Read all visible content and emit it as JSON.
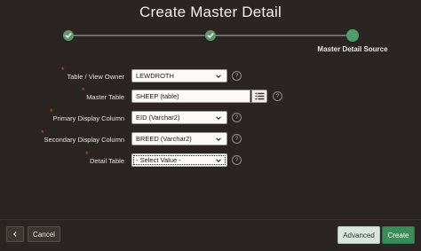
{
  "dialog": {
    "title": "Create Master Detail"
  },
  "wizard": {
    "steps": [
      {
        "state": "complete",
        "icon": "check-icon"
      },
      {
        "state": "complete",
        "icon": "check-icon"
      },
      {
        "state": "current",
        "label": "Master Detail Source"
      }
    ]
  },
  "form": {
    "table_owner": {
      "label": "Table / View Owner",
      "required": "*",
      "value": "LEWDROTH"
    },
    "master_table": {
      "label": "Master Table",
      "required": "*",
      "value": "SHEEP (table)"
    },
    "primary_display": {
      "label": "Primary Display Column",
      "required": "*",
      "value": "EID (Varchar2)"
    },
    "secondary_display": {
      "label": "Secondary Display Column",
      "required": "*",
      "value": "BREED (Varchar2)"
    },
    "detail_table": {
      "label": "Detail Table",
      "required": "*",
      "value": "- Select Value -"
    },
    "help_glyph": "?"
  },
  "footer": {
    "back_icon": "chevron-left-icon",
    "cancel_label": "Cancel",
    "advanced_label": "Advanced",
    "create_label": "Create"
  },
  "colors": {
    "background": "#2a2522",
    "step_complete": "#5e9a67",
    "create_button": "#3d8b57",
    "required_marker": "#e1443a"
  }
}
